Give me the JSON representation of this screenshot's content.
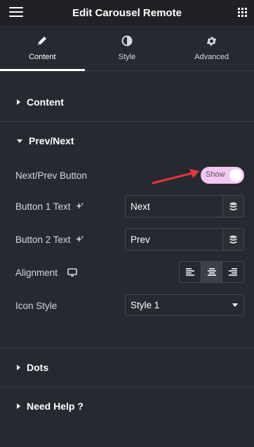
{
  "header": {
    "title": "Edit Carousel Remote"
  },
  "tabs": [
    {
      "label": "Content",
      "icon": "pencil-icon",
      "active": true
    },
    {
      "label": "Style",
      "icon": "half-circle-icon",
      "active": false
    },
    {
      "label": "Advanced",
      "icon": "gear-icon",
      "active": false
    }
  ],
  "sections": {
    "content": {
      "title": "Content",
      "expanded": false
    },
    "prevnext": {
      "title": "Prev/Next",
      "expanded": true,
      "next_prev_button": {
        "label": "Next/Prev Button",
        "toggle_text": "Show",
        "on": true
      },
      "button1": {
        "label": "Button 1 Text",
        "value": "Next"
      },
      "button2": {
        "label": "Button 2 Text",
        "value": "Prev"
      },
      "alignment": {
        "label": "Alignment",
        "options": [
          "left",
          "center",
          "right"
        ],
        "selected": "center"
      },
      "icon_style": {
        "label": "Icon Style",
        "value": "Style 1"
      }
    },
    "dots": {
      "title": "Dots",
      "expanded": false
    },
    "help": {
      "title": "Need Help ?",
      "expanded": false
    }
  },
  "colors": {
    "background": "#26292f",
    "header": "#1f2124",
    "toggle": "#f5c6f4",
    "annotation_arrow": "#e8353a"
  }
}
